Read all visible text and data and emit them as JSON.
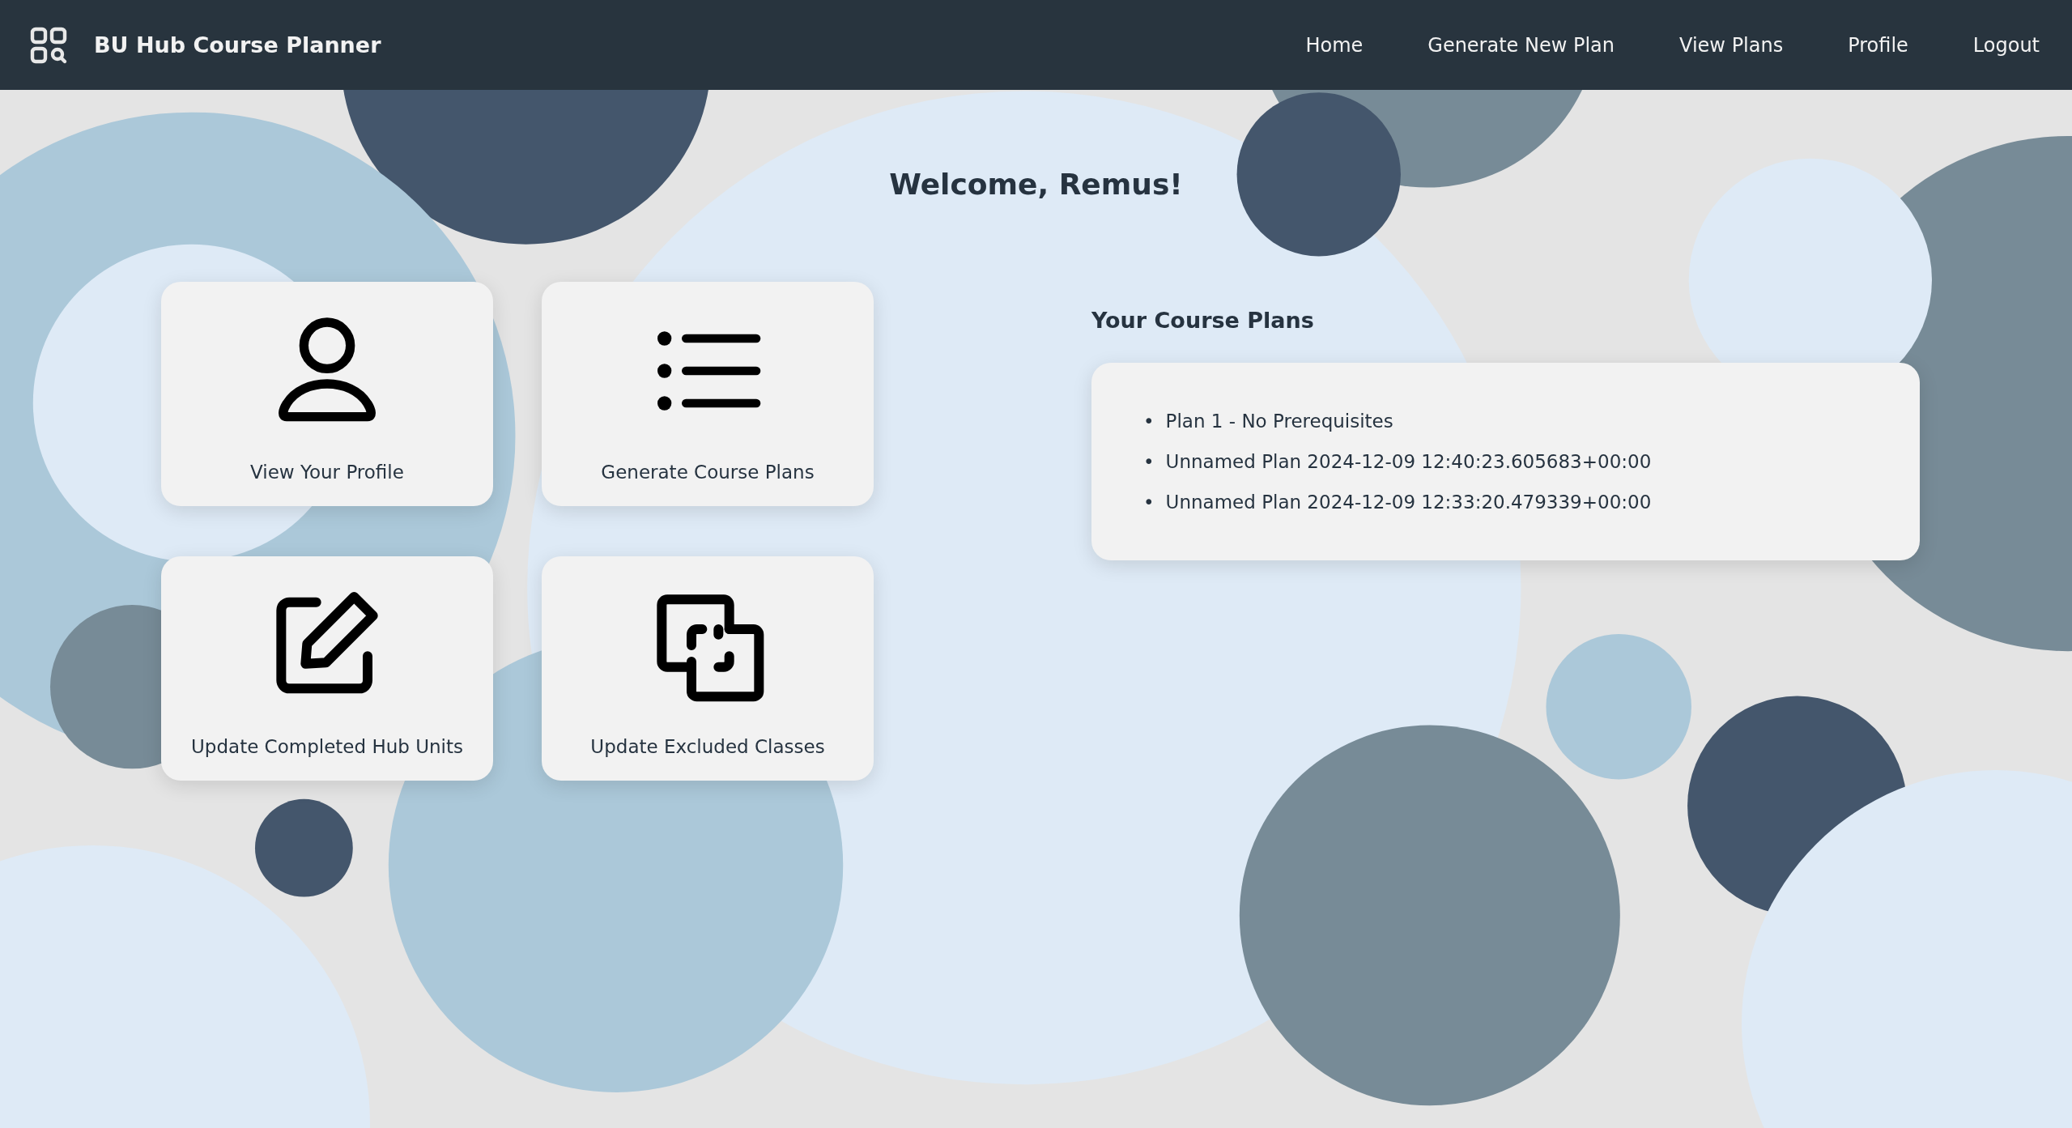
{
  "header": {
    "title": "BU Hub Course Planner",
    "nav": [
      "Home",
      "Generate New Plan",
      "View Plans",
      "Profile",
      "Logout"
    ]
  },
  "welcome": "Welcome, Remus!",
  "cards": [
    {
      "label": "View Your Profile",
      "kind": "profile"
    },
    {
      "label": "Generate Course Plans",
      "kind": "list"
    },
    {
      "label": "Update Completed Hub Units",
      "kind": "edit"
    },
    {
      "label": "Update Excluded Classes",
      "kind": "exclude"
    }
  ],
  "plans": {
    "title": "Your Course Plans",
    "items": [
      {
        "bullet": "•",
        "text": "Plan 1 - No Prerequisites"
      },
      {
        "bullet": "•",
        "text": "Unnamed Plan 2024-12-09 12:40:23.605683+00:00"
      },
      {
        "bullet": "•",
        "text": "Unnamed Plan 2024-12-09 12:33:20.479339+00:00"
      }
    ]
  }
}
